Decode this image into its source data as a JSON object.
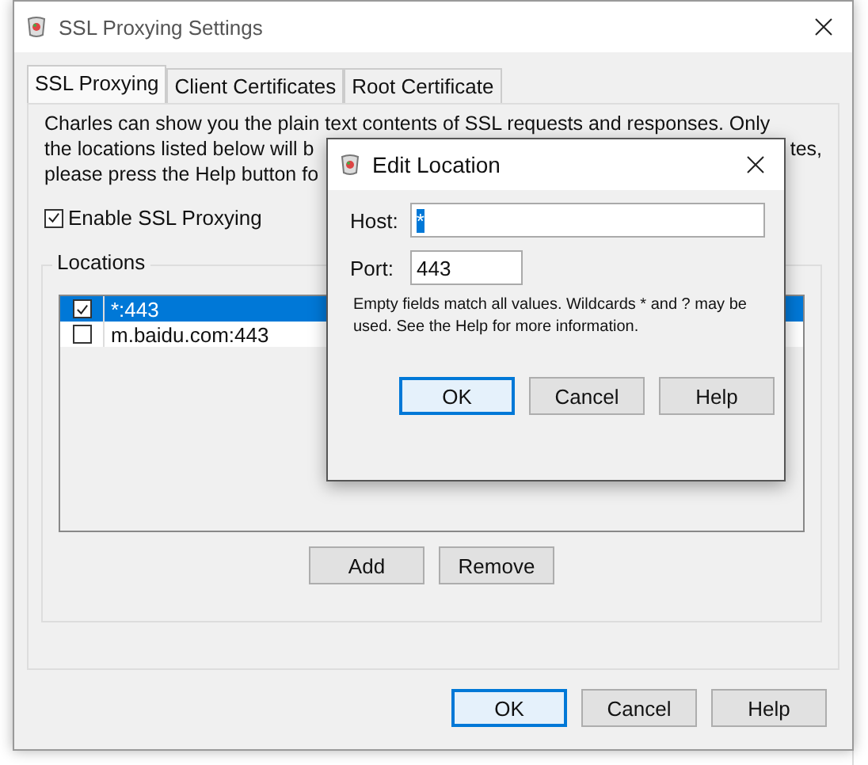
{
  "window": {
    "title": "SSL Proxying Settings",
    "tabs": [
      {
        "label": "SSL Proxying",
        "selected": true
      },
      {
        "label": "Client Certificates",
        "selected": false
      },
      {
        "label": "Root Certificate",
        "selected": false
      }
    ],
    "description_lines": [
      [
        "Charles can show you the plain text contents of SSL requests and responses. Only"
      ],
      [
        "the locations listed below will b",
        "tes,"
      ],
      [
        "please press the Help button fo"
      ]
    ],
    "enable_ssl_proxying": {
      "label": "Enable SSL Proxying",
      "checked": true
    },
    "locations": {
      "title": "Locations",
      "rows": [
        {
          "text": "*:443",
          "checked": true,
          "selected": true
        },
        {
          "text": "m.baidu.com:443",
          "checked": false,
          "selected": false
        }
      ],
      "buttons": [
        "Add",
        "Remove"
      ]
    },
    "buttons": [
      {
        "label": "OK",
        "default": true
      },
      {
        "label": "Cancel",
        "default": false
      },
      {
        "label": "Help",
        "default": false
      }
    ]
  },
  "dialog": {
    "title": "Edit Location",
    "host_label": "Host:",
    "host": "*",
    "port_label": "Port:",
    "port": "443",
    "note": "Empty fields match all values. Wildcards * and ? may be used. See the Help for more information.",
    "buttons": [
      {
        "label": "OK",
        "default": true
      },
      {
        "label": "Cancel",
        "default": false
      },
      {
        "label": "Help",
        "default": false
      }
    ]
  }
}
